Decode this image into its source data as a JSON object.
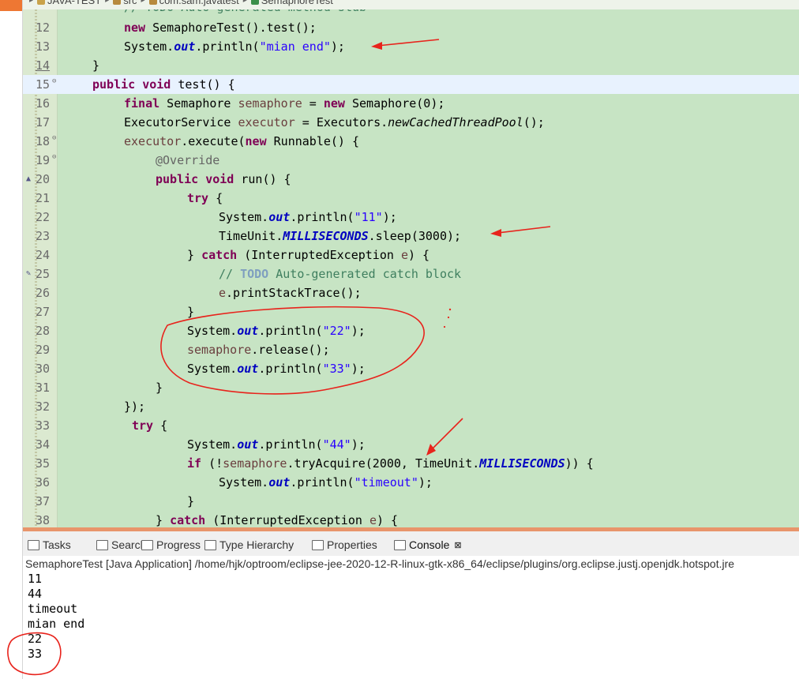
{
  "breadcrumb": [
    "JAVA-TEST",
    "src",
    "com.sam.javatest",
    "SemaphoreTest"
  ],
  "top_partial_comment": "// TODO Auto-generated method stub",
  "code_lines": [
    {
      "n": "12",
      "t": [
        [
          "kw",
          "new"
        ],
        [
          "p",
          " SemaphoreTest().test();"
        ]
      ]
    },
    {
      "n": "13",
      "t": [
        [
          "p",
          "System."
        ],
        [
          "fld",
          "out"
        ],
        [
          "p",
          ".println("
        ],
        [
          "str",
          "\"mian end\""
        ],
        [
          "p",
          ");"
        ]
      ]
    },
    {
      "n": "14",
      "t": [
        [
          "p",
          "}"
        ]
      ]
    },
    {
      "n": "15",
      "t": [
        [
          "kw",
          "public void"
        ],
        [
          "p",
          " test() {"
        ]
      ]
    },
    {
      "n": "16",
      "t": [
        [
          "kw",
          "final"
        ],
        [
          "p",
          " Semaphore "
        ],
        [
          "var",
          "semaphore"
        ],
        [
          "p",
          " = "
        ],
        [
          "kw",
          "new"
        ],
        [
          "p",
          " Semaphore(0);"
        ]
      ]
    },
    {
      "n": "17",
      "t": [
        [
          "p",
          "ExecutorService "
        ],
        [
          "var",
          "executor"
        ],
        [
          "p",
          " = Executors."
        ],
        [
          "ital",
          "newCachedThreadPool"
        ],
        [
          "p",
          "();"
        ]
      ]
    },
    {
      "n": "18",
      "t": [
        [
          "var",
          "executor"
        ],
        [
          "p",
          ".execute("
        ],
        [
          "kw",
          "new"
        ],
        [
          "p",
          " Runnable() {"
        ]
      ]
    },
    {
      "n": "19",
      "t": [
        [
          "ann",
          "@Override"
        ]
      ]
    },
    {
      "n": "20",
      "t": [
        [
          "kw",
          "public void"
        ],
        [
          "p",
          " run() {"
        ]
      ]
    },
    {
      "n": "21",
      "t": [
        [
          "kw",
          "try"
        ],
        [
          "p",
          " {"
        ]
      ]
    },
    {
      "n": "22",
      "t": [
        [
          "p",
          "System."
        ],
        [
          "fld",
          "out"
        ],
        [
          "p",
          ".println("
        ],
        [
          "str",
          "\"11\""
        ],
        [
          "p",
          ");"
        ]
      ]
    },
    {
      "n": "23",
      "t": [
        [
          "p",
          "TimeUnit."
        ],
        [
          "fld",
          "MILLISECONDS"
        ],
        [
          "p",
          ".sleep(3000);"
        ]
      ]
    },
    {
      "n": "24",
      "t": [
        [
          "p",
          "} "
        ],
        [
          "kw",
          "catch"
        ],
        [
          "p",
          " (InterruptedException "
        ],
        [
          "var",
          "e"
        ],
        [
          "p",
          ") {"
        ]
      ]
    },
    {
      "n": "25",
      "t": [
        [
          "cmt",
          "// "
        ],
        [
          "todo",
          "TODO"
        ],
        [
          "cmt",
          " Auto-generated catch block"
        ]
      ]
    },
    {
      "n": "26",
      "t": [
        [
          "var",
          "e"
        ],
        [
          "p",
          ".printStackTrace();"
        ]
      ]
    },
    {
      "n": "27",
      "t": [
        [
          "p",
          "}"
        ]
      ]
    },
    {
      "n": "28",
      "t": [
        [
          "p",
          "System."
        ],
        [
          "fld",
          "out"
        ],
        [
          "p",
          ".println("
        ],
        [
          "str",
          "\"22\""
        ],
        [
          "p",
          ");"
        ]
      ]
    },
    {
      "n": "29",
      "t": [
        [
          "var",
          "semaphore"
        ],
        [
          "p",
          ".release();"
        ]
      ]
    },
    {
      "n": "30",
      "t": [
        [
          "p",
          "System."
        ],
        [
          "fld",
          "out"
        ],
        [
          "p",
          ".println("
        ],
        [
          "str",
          "\"33\""
        ],
        [
          "p",
          ");"
        ]
      ]
    },
    {
      "n": "31",
      "t": [
        [
          "p",
          "}"
        ]
      ]
    },
    {
      "n": "32",
      "t": [
        [
          "p",
          "});"
        ]
      ]
    },
    {
      "n": "33",
      "t": [
        [
          "kw",
          "try"
        ],
        [
          "p",
          " {"
        ]
      ]
    },
    {
      "n": "34",
      "t": [
        [
          "p",
          "System."
        ],
        [
          "fld",
          "out"
        ],
        [
          "p",
          ".println("
        ],
        [
          "str",
          "\"44\""
        ],
        [
          "p",
          ");"
        ]
      ]
    },
    {
      "n": "35",
      "t": [
        [
          "kw",
          "if"
        ],
        [
          "p",
          " (!"
        ],
        [
          "var",
          "semaphore"
        ],
        [
          "p",
          ".tryAcquire(2000, TimeUnit."
        ],
        [
          "fld",
          "MILLISECONDS"
        ],
        [
          "p",
          ")) {"
        ]
      ]
    },
    {
      "n": "36",
      "t": [
        [
          "p",
          "System."
        ],
        [
          "fld",
          "out"
        ],
        [
          "p",
          ".println("
        ],
        [
          "str",
          "\"timeout\""
        ],
        [
          "p",
          ");"
        ]
      ]
    },
    {
      "n": "37",
      "t": [
        [
          "p",
          "}"
        ]
      ]
    },
    {
      "n": "38",
      "t": [
        [
          "p",
          "} "
        ],
        [
          "kw",
          "catch"
        ],
        [
          "p",
          " (InterruptedException "
        ],
        [
          "var",
          "e"
        ],
        [
          "p",
          ") {"
        ]
      ]
    }
  ],
  "tabs": [
    {
      "label": "Tasks",
      "icon": "tasks-icon"
    },
    {
      "label": "Search",
      "icon": "search-icon"
    },
    {
      "label": "Progress",
      "icon": "progress-icon"
    },
    {
      "label": "Type Hierarchy",
      "icon": "type-hierarchy-icon"
    },
    {
      "label": "Properties",
      "icon": "properties-icon"
    },
    {
      "label": "Console",
      "icon": "console-icon",
      "active": true
    }
  ],
  "console_title": "SemaphoreTest [Java Application] /home/hjk/optroom/eclipse-jee-2020-12-R-linux-gtk-x86_64/eclipse/plugins/org.eclipse.justj.openjdk.hotspot.jre",
  "console_output": [
    "11",
    "44",
    "timeout",
    "mian end",
    "22",
    "33"
  ],
  "colors": {
    "editor_bg": "#c7e4c4",
    "annotation": "#e8231c",
    "divider": "#e8956b"
  }
}
